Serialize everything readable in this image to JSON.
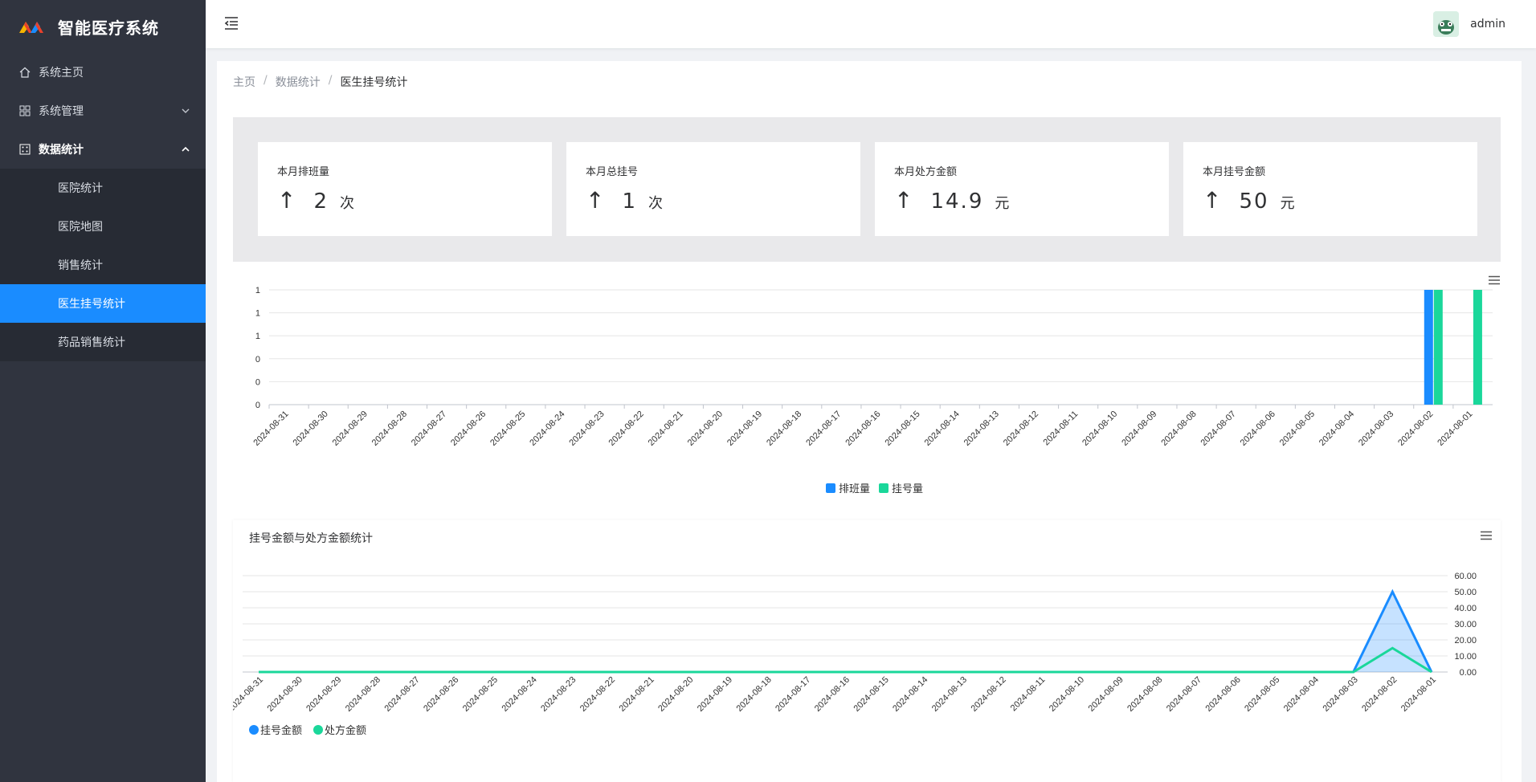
{
  "app": {
    "title": "智能医疗系统"
  },
  "sidebar": {
    "items": [
      {
        "label": "系统主页",
        "icon": "home-icon"
      },
      {
        "label": "系统管理",
        "icon": "grid-icon"
      },
      {
        "label": "数据统计",
        "icon": "stats-icon"
      }
    ],
    "submenu": [
      {
        "label": "医院统计"
      },
      {
        "label": "医院地图"
      },
      {
        "label": "销售统计"
      },
      {
        "label": "医生挂号统计",
        "active": true
      },
      {
        "label": "药品销售统计"
      }
    ]
  },
  "header": {
    "username": "admin"
  },
  "breadcrumb": {
    "home": "主页",
    "parent": "数据统计",
    "current": "医生挂号统计",
    "separator": "/"
  },
  "stats": [
    {
      "label": "本月排班量",
      "arrow": "↑",
      "value": "2",
      "unit": "次"
    },
    {
      "label": "本月总挂号",
      "arrow": "↑",
      "value": "1",
      "unit": "次"
    },
    {
      "label": "本月处方金额",
      "arrow": "↑",
      "value": "14.9",
      "unit": "元"
    },
    {
      "label": "本月挂号金额",
      "arrow": "↑",
      "value": "50",
      "unit": "元"
    }
  ],
  "colors": {
    "accent": "#1a8cff",
    "series_blue": "#1a8cff",
    "series_green": "#1ad79a",
    "sidebar_bg": "#30343f"
  },
  "chart_data": [
    {
      "type": "bar",
      "title": "",
      "categories": [
        "2024-08-31",
        "2024-08-30",
        "2024-08-29",
        "2024-08-28",
        "2024-08-27",
        "2024-08-26",
        "2024-08-25",
        "2024-08-24",
        "2024-08-23",
        "2024-08-22",
        "2024-08-21",
        "2024-08-20",
        "2024-08-19",
        "2024-08-18",
        "2024-08-17",
        "2024-08-16",
        "2024-08-15",
        "2024-08-14",
        "2024-08-13",
        "2024-08-12",
        "2024-08-11",
        "2024-08-10",
        "2024-08-09",
        "2024-08-08",
        "2024-08-07",
        "2024-08-06",
        "2024-08-05",
        "2024-08-04",
        "2024-08-03",
        "2024-08-02",
        "2024-08-01"
      ],
      "series": [
        {
          "name": "排班量",
          "color": "#1a8cff",
          "values": [
            0,
            0,
            0,
            0,
            0,
            0,
            0,
            0,
            0,
            0,
            0,
            0,
            0,
            0,
            0,
            0,
            0,
            0,
            0,
            0,
            0,
            0,
            0,
            0,
            0,
            0,
            0,
            0,
            0,
            1,
            0
          ]
        },
        {
          "name": "挂号量",
          "color": "#1ad79a",
          "values": [
            0,
            0,
            0,
            0,
            0,
            0,
            0,
            0,
            0,
            0,
            0,
            0,
            0,
            0,
            0,
            0,
            0,
            0,
            0,
            0,
            0,
            0,
            0,
            0,
            0,
            0,
            0,
            0,
            0,
            1,
            1
          ]
        }
      ],
      "ytick_labels": [
        "0",
        "0",
        "0",
        "1",
        "1",
        "1"
      ],
      "ylim": [
        0,
        1
      ],
      "legend": "bottom-center",
      "grid": true
    },
    {
      "type": "area",
      "title": "挂号金额与处方金额统计",
      "categories": [
        "2024-08-31",
        "2024-08-30",
        "2024-08-29",
        "2024-08-28",
        "2024-08-27",
        "2024-08-26",
        "2024-08-25",
        "2024-08-24",
        "2024-08-23",
        "2024-08-22",
        "2024-08-21",
        "2024-08-20",
        "2024-08-19",
        "2024-08-18",
        "2024-08-17",
        "2024-08-16",
        "2024-08-15",
        "2024-08-14",
        "2024-08-13",
        "2024-08-12",
        "2024-08-11",
        "2024-08-10",
        "2024-08-09",
        "2024-08-08",
        "2024-08-07",
        "2024-08-06",
        "2024-08-05",
        "2024-08-04",
        "2024-08-03",
        "2024-08-02",
        "2024-08-01"
      ],
      "series": [
        {
          "name": "挂号金额",
          "color": "#1a8cff",
          "values": [
            0,
            0,
            0,
            0,
            0,
            0,
            0,
            0,
            0,
            0,
            0,
            0,
            0,
            0,
            0,
            0,
            0,
            0,
            0,
            0,
            0,
            0,
            0,
            0,
            0,
            0,
            0,
            0,
            0,
            50,
            0
          ]
        },
        {
          "name": "处方金额",
          "color": "#1ad79a",
          "values": [
            0,
            0,
            0,
            0,
            0,
            0,
            0,
            0,
            0,
            0,
            0,
            0,
            0,
            0,
            0,
            0,
            0,
            0,
            0,
            0,
            0,
            0,
            0,
            0,
            0,
            0,
            0,
            0,
            0,
            14.9,
            0
          ]
        }
      ],
      "ytick_labels": [
        "0.00",
        "10.00",
        "20.00",
        "30.00",
        "40.00",
        "50.00",
        "60.00"
      ],
      "ylim": [
        0,
        60
      ],
      "yaxis_side": "right",
      "legend": "bottom-left",
      "grid": true
    }
  ]
}
